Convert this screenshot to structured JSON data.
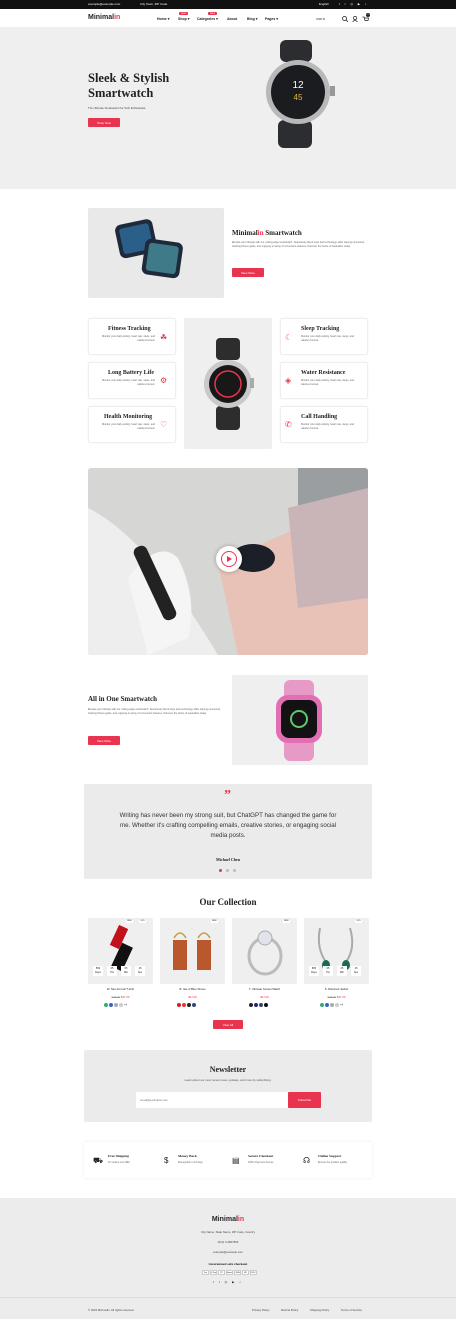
{
  "topbar": {
    "email": "example@example.com",
    "address": "City Town, ZIP Code",
    "language": "English",
    "social": [
      "f",
      "t",
      "in",
      "yt",
      "tk"
    ]
  },
  "header": {
    "logo_main": "Minimal",
    "logo_accent": "in",
    "nav": [
      {
        "label": "Home"
      },
      {
        "label": "Shop",
        "badge": "NEW"
      },
      {
        "label": "Categories",
        "badge": "SALE"
      },
      {
        "label": "About"
      },
      {
        "label": "Blog"
      },
      {
        "label": "Pages"
      }
    ],
    "currency": "USD $",
    "cart_count": "0"
  },
  "hero": {
    "title_line1": "Sleek & Stylish",
    "title_line2": "Smartwatch",
    "subtitle": "The Ultimate Smartwatch for Tech Enthusiasts.",
    "button": "Shop Now"
  },
  "intro": {
    "title_accent": "in",
    "title_main": "Minimal",
    "title_rest": " Smartwatch",
    "text": "Elevate your lifestyle with our cutting-edge smartwatch. Seamlessly blend style and technology while staying connected, tracking fitness goals, and enjoying an array of convenient features. Discover the future of wearables today.",
    "button": "View More"
  },
  "features": [
    {
      "title": "Fitness Tracking",
      "text": "Monitor your daily activity, heart rate, steps, and calories burned."
    },
    {
      "title": "Long Battery Life",
      "text": "Monitor your daily activity, heart rate, steps, and calories burned."
    },
    {
      "title": "Health Monitoring",
      "text": "Monitor your daily activity, heart rate, steps, and calories burned."
    },
    {
      "title": "Sleep Tracking",
      "text": "Monitor your daily activity, heart rate, steps, and calories burned."
    },
    {
      "title": "Water Resistance",
      "text": "Monitor your daily activity, heart rate, steps, and calories burned."
    },
    {
      "title": "Call Handling",
      "text": "Monitor your daily activity, heart rate, steps, and calories burned."
    }
  ],
  "allinone": {
    "title": "All in One Smartwatch",
    "text": "Elevate your lifestyle with our cutting-edge smartwatch. Seamlessly blend style and technology while staying connected, tracking fitness goals, and enjoying an array of convenient features. Discover the future of wearables today.",
    "button": "View More"
  },
  "testimonial": {
    "quote_mark": "”",
    "text_line1": "Writing has never been my strong suit, but ChatGPT has changed the game for",
    "text_line2": "me. Whether it's crafting compelling emails, creative stories, or engaging social",
    "text_line3": "media posts.",
    "author": "Michael Chen"
  },
  "collection": {
    "title": "Our Collection",
    "button": "View All",
    "products": [
      {
        "name": "W. Neo-Formal T-shirt",
        "old": "$79.00",
        "price": "$47.00",
        "tags": [
          "NEW",
          "-19%"
        ],
        "countdown": [
          {
            "v": "569",
            "l": "Days"
          },
          {
            "v": "05",
            "l": "Hrs"
          },
          {
            "v": "05",
            "l": "Min"
          },
          {
            "v": "15",
            "l": "Sec"
          }
        ],
        "swatches": [
          "#3a7",
          "#36c",
          "#aaa",
          "#ccc"
        ],
        "more": "+4"
      },
      {
        "name": "B. Isle of Blue Shoes",
        "old": "",
        "price": "$47.00",
        "tags": [
          "NEW"
        ],
        "countdown": [],
        "swatches": [
          "#c22",
          "#e33",
          "#222",
          "#348"
        ],
        "more": ""
      },
      {
        "name": "T. Ultimate Sunset Watch",
        "old": "",
        "price": "$47.00",
        "tags": [
          "NEW"
        ],
        "countdown": [],
        "swatches": [
          "#222",
          "#228",
          "#346",
          "#111"
        ],
        "more": ""
      },
      {
        "name": "S. Distorted Jacket",
        "old": "$79.00",
        "price": "$47.00",
        "tags": [
          "-19%"
        ],
        "countdown": [
          {
            "v": "805",
            "l": "Days"
          },
          {
            "v": "05",
            "l": "Hrs"
          },
          {
            "v": "05",
            "l": "Min"
          },
          {
            "v": "15",
            "l": "Sec"
          }
        ],
        "swatches": [
          "#3a7",
          "#36c",
          "#aaa",
          "#ccc"
        ],
        "more": "+4"
      }
    ]
  },
  "newsletter": {
    "title": "Newsletter",
    "subtitle": "Learn about our most recent news, updates, and more by subscribing.",
    "placeholder": "email@example.com",
    "button": "Subscribe"
  },
  "services": [
    {
      "title": "Free Shipping",
      "text": "On orders over $99"
    },
    {
      "title": "Money Back",
      "text": "Moneyback in 15 days"
    },
    {
      "title": "Secure Checkout",
      "text": "100% Payment Secure"
    },
    {
      "title": "Online Support",
      "text": "Ensure the product quality"
    }
  ],
  "footer": {
    "logo_main": "Minimal",
    "logo_accent": "in",
    "address": "City Name, State Name, ZIP Code, Country",
    "phone": "(012) 3-4567890",
    "email": "example@example.com",
    "checkout": "Guaranteed safe checkout",
    "payments": [
      "Pay",
      "G Pay",
      "PP",
      "Amex",
      "VISA",
      "MC",
      "DISC"
    ],
    "copyright": "© 2024 Minimalin. All rights reserved.",
    "links": [
      "Privacy Policy",
      "Refund Policy",
      "Shipping Policy",
      "Terms of Service"
    ]
  }
}
